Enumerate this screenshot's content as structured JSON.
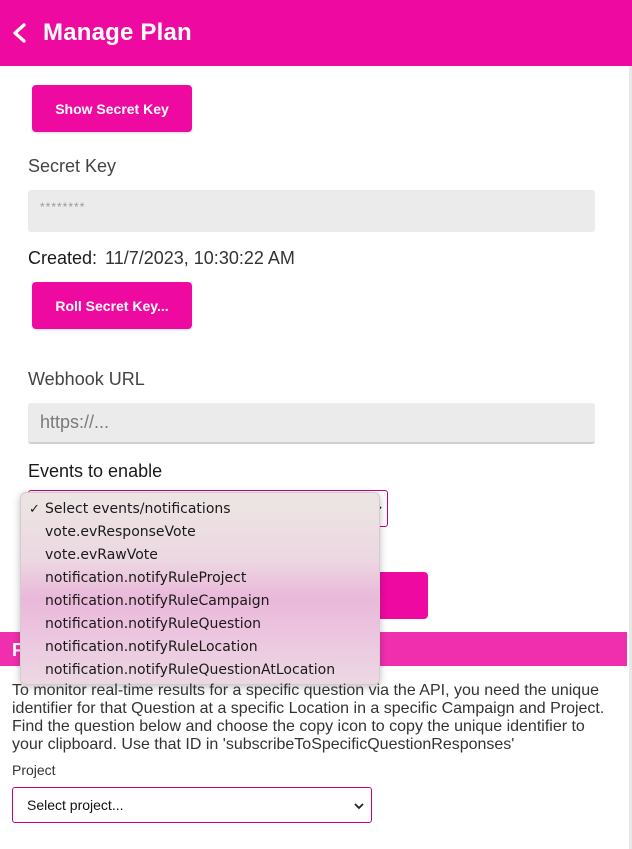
{
  "header": {
    "title": "Manage Plan",
    "back_icon": "chevron-left-icon"
  },
  "secret": {
    "show_button": "Show Secret Key",
    "label": "Secret Key",
    "value": "********",
    "created_label": "Created:",
    "created_value": "11/7/2023, 10:30:22 AM",
    "roll_button": "Roll Secret Key..."
  },
  "webhook": {
    "label": "Webhook URL",
    "placeholder": "https://..."
  },
  "events": {
    "label": "Events to enable",
    "selected": "Select events/notifications",
    "options": [
      "Select events/notifications",
      "vote.evResponseVote",
      "vote.evRawVote",
      "notification.notifyRuleProject",
      "notification.notifyRuleCampaign",
      "notification.notifyRuleQuestion",
      "notification.notifyRuleLocation",
      "notification.notifyRuleQuestionAtLocation"
    ]
  },
  "section": {
    "initial": "F",
    "description": "To monitor real-time results for a specific question via the API, you need the unique identifier for that Question at a specific Location in a specific Campaign and Project. Find the question below and choose the copy icon to copy the unique identifier to your clipboard. Use that ID in 'subscribeToSpecificQuestionResponses'",
    "project_label": "Project",
    "project_selected": "Select project..."
  },
  "colors": {
    "accent": "#ee0aa0",
    "section_bar": "#f02fae"
  }
}
